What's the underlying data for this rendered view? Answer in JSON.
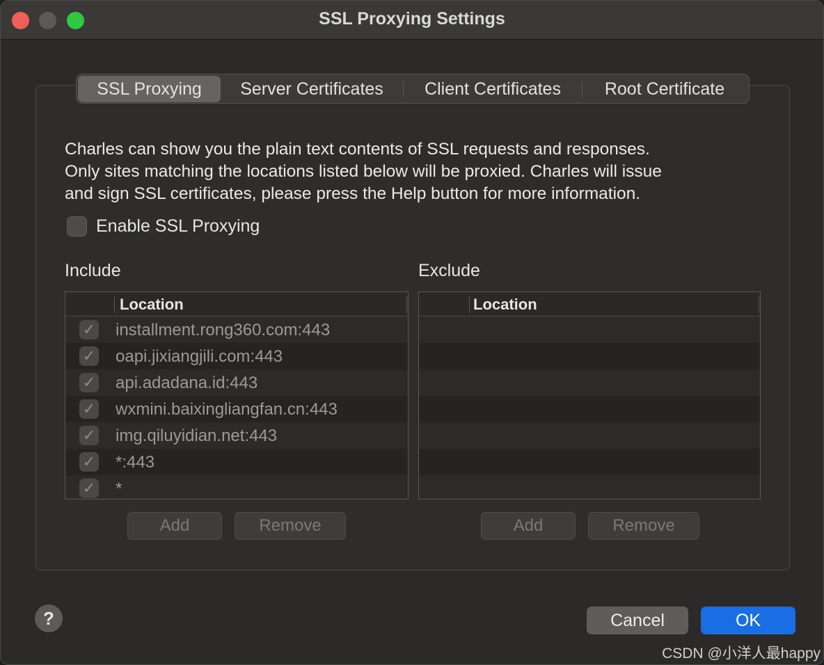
{
  "window": {
    "title": "SSL Proxying Settings"
  },
  "tabs": [
    {
      "label": "SSL Proxying",
      "active": true
    },
    {
      "label": "Server Certificates",
      "active": false
    },
    {
      "label": "Client Certificates",
      "active": false
    },
    {
      "label": "Root Certificate",
      "active": false
    }
  ],
  "description": [
    "Charles can show you the plain text contents of SSL requests and responses.",
    "Only sites matching the locations listed below will be proxied. Charles will issue",
    "and sign SSL certificates, please press the Help button for more information."
  ],
  "enable_ssl": {
    "label": "Enable SSL Proxying",
    "checked": false
  },
  "include": {
    "label": "Include",
    "column": "Location",
    "rows": [
      {
        "location": "installment.rong360.com:443",
        "checked": true
      },
      {
        "location": "oapi.jixiangjili.com:443",
        "checked": true
      },
      {
        "location": "api.adadana.id:443",
        "checked": true
      },
      {
        "location": "wxmini.baixingliangfan.cn:443",
        "checked": true
      },
      {
        "location": "img.qiluyidian.net:443",
        "checked": true
      },
      {
        "location": "*:443",
        "checked": true
      },
      {
        "location": "*",
        "checked": true
      }
    ],
    "add_label": "Add",
    "remove_label": "Remove"
  },
  "exclude": {
    "label": "Exclude",
    "column": "Location",
    "rows": [],
    "add_label": "Add",
    "remove_label": "Remove"
  },
  "footer": {
    "help_label": "?",
    "cancel_label": "Cancel",
    "ok_label": "OK",
    "accent_color": "#1a6de3"
  },
  "watermark": "CSDN @小洋人最happy",
  "icons": {
    "checkmark": "✓"
  }
}
